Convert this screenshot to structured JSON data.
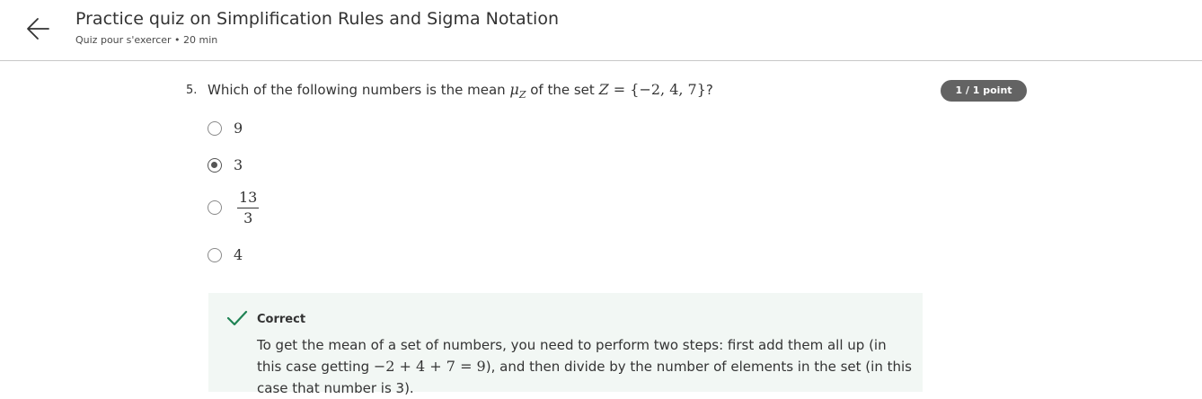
{
  "header": {
    "title": "Practice quiz on Simplification Rules and Sigma Notation",
    "subtitle": "Quiz pour s'exercer • 20 min"
  },
  "question": {
    "number": "5.",
    "text_before": "Which of the following numbers is the mean ",
    "mean_symbol": "μ",
    "mean_sub": "Z",
    "text_middle": " of the set ",
    "set_var": "Z",
    "set_eq": " = {−2, 4, 7}",
    "text_end": "?",
    "points": "1 / 1 point",
    "options": [
      {
        "label": "9",
        "selected": false
      },
      {
        "label": "3",
        "selected": true
      },
      {
        "numerator": "13",
        "denominator": "3",
        "selected": false
      },
      {
        "label": "4",
        "selected": false
      }
    ]
  },
  "feedback": {
    "status": "Correct",
    "text_part1": "To get the mean of a set of numbers, you need to perform two steps: first add them all up (in this case getting ",
    "expr": "−2 + 4 + 7 = 9",
    "text_part2": "), and then divide by the number of elements in the set (in this case that number is 3)."
  },
  "colors": {
    "correct": "#1f8354",
    "badge": "#636363",
    "feedback_bg": "#f2f7f4"
  }
}
